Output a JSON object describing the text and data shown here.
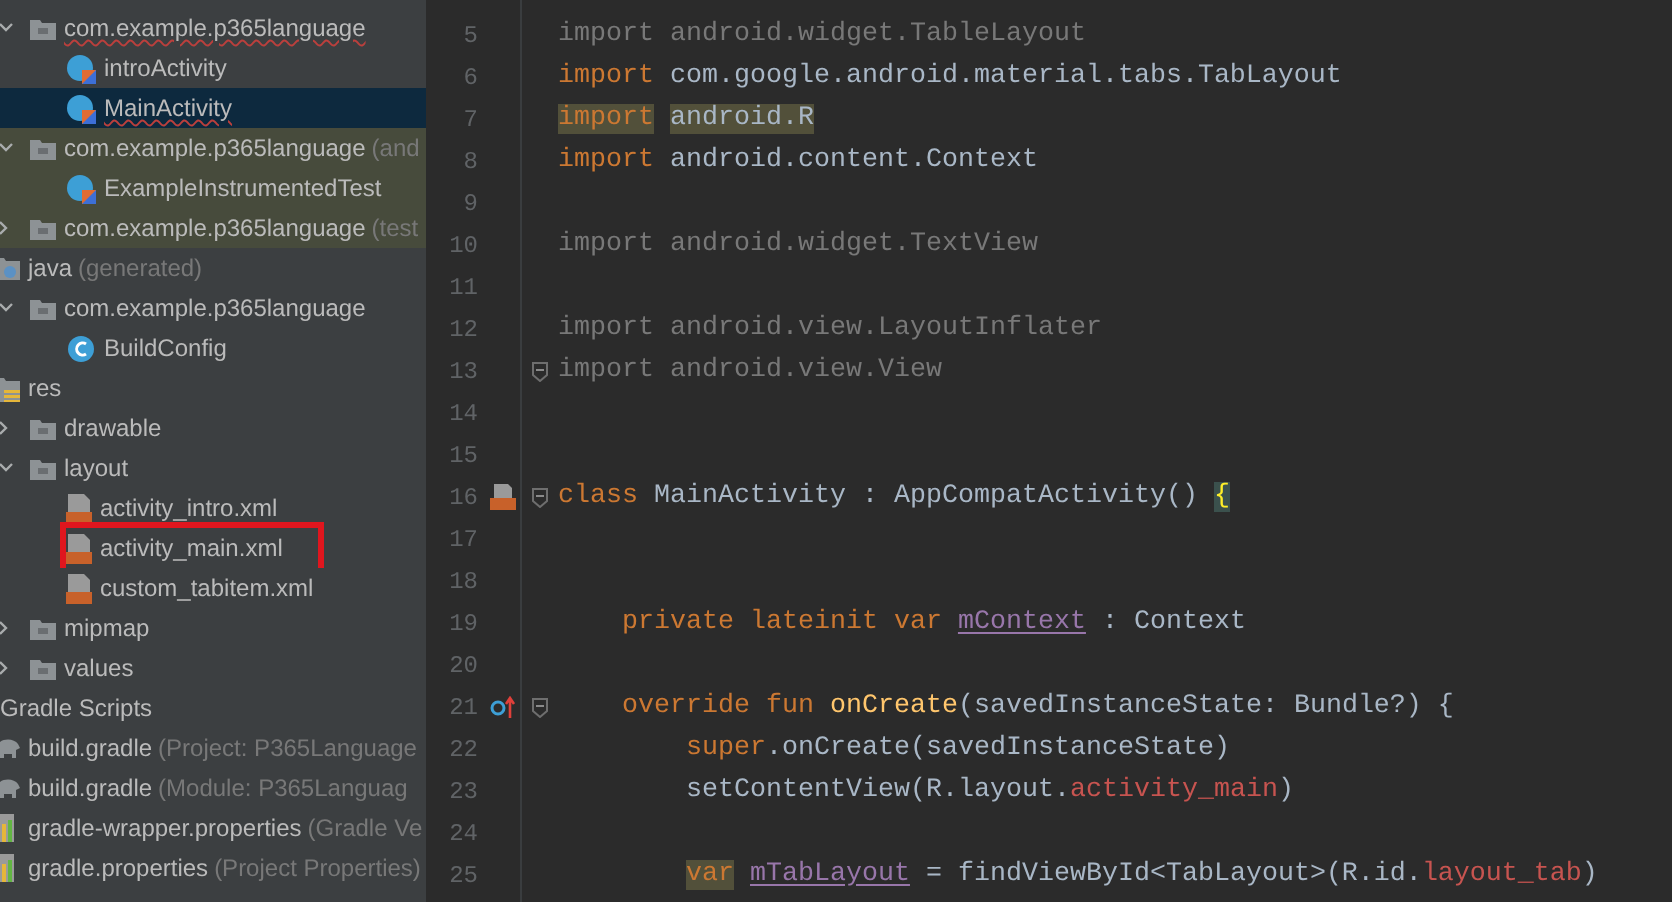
{
  "project_tree": {
    "continued": [
      {
        "label": "com.example.p365language",
        "kind": "package",
        "expanded": true,
        "selected": false,
        "test_scope": false,
        "spell_error": true,
        "children": [
          {
            "label": "introActivity",
            "kind": "kotlin-class",
            "selected": false,
            "test_scope": false,
            "spell_error": false
          },
          {
            "label": "MainActivity",
            "kind": "kotlin-class",
            "selected": true,
            "test_scope": false,
            "spell_error": true
          }
        ]
      },
      {
        "label": "com.example.p365language",
        "note": "(and",
        "kind": "package",
        "expanded": true,
        "selected": false,
        "test_scope": true,
        "spell_error": false,
        "children": [
          {
            "label": "ExampleInstrumentedTest",
            "kind": "kotlin-class",
            "selected": false,
            "test_scope": true,
            "spell_error": false
          }
        ]
      },
      {
        "label": "com.example.p365language",
        "note": "(test",
        "kind": "package",
        "expanded": false,
        "selected": false,
        "test_scope": true,
        "spell_error": false
      }
    ],
    "items": [
      {
        "label": "java",
        "note": "(generated)",
        "kind": "generated-folder",
        "selected": false,
        "test_scope": false,
        "spell_error": false,
        "children": [
          {
            "label": "com.example.p365language",
            "kind": "package",
            "expanded": true,
            "selected": false,
            "test_scope": false,
            "spell_error": false,
            "children": [
              {
                "label": "BuildConfig",
                "kind": "java-class",
                "selected": false,
                "test_scope": false,
                "spell_error": false
              }
            ]
          }
        ]
      },
      {
        "label": "res",
        "kind": "resource-folder",
        "selected": false,
        "test_scope": false,
        "spell_error": false,
        "children": [
          {
            "label": "drawable",
            "kind": "package",
            "expanded": false,
            "selected": false,
            "test_scope": false,
            "spell_error": false
          },
          {
            "label": "layout",
            "kind": "package",
            "expanded": true,
            "selected": false,
            "test_scope": false,
            "spell_error": false,
            "children": [
              {
                "label": "activity_intro.xml",
                "kind": "xml-file",
                "selected": false,
                "test_scope": false,
                "spell_error": false,
                "outlined": false
              },
              {
                "label": "activity_main.xml",
                "kind": "xml-file",
                "selected": false,
                "test_scope": false,
                "spell_error": false,
                "outlined": true
              },
              {
                "label": "custom_tabitem.xml",
                "kind": "xml-file",
                "selected": false,
                "test_scope": false,
                "spell_error": false,
                "outlined": false
              }
            ]
          },
          {
            "label": "mipmap",
            "kind": "package",
            "expanded": false,
            "selected": false,
            "test_scope": false,
            "spell_error": false
          },
          {
            "label": "values",
            "kind": "package",
            "expanded": false,
            "selected": false,
            "test_scope": false,
            "spell_error": false
          }
        ]
      }
    ],
    "gradle_scripts": {
      "label": "Gradle Scripts",
      "children": [
        {
          "label": "build.gradle",
          "note": "(Project: P365Language",
          "kind": "gradle-file",
          "selected": false,
          "test_scope": false,
          "spell_error": false
        },
        {
          "label": "build.gradle",
          "note": "(Module: P365Languag",
          "kind": "gradle-file",
          "selected": false,
          "test_scope": false,
          "spell_error": false
        },
        {
          "label": "gradle-wrapper.properties",
          "note": "(Gradle Ve",
          "kind": "properties-file",
          "selected": false,
          "test_scope": false,
          "spell_error": false
        },
        {
          "label": "gradle.properties",
          "note": "(Project Properties)",
          "kind": "properties-file",
          "selected": false,
          "test_scope": false,
          "spell_error": false
        }
      ]
    }
  },
  "editor": {
    "lines": [
      {
        "number": "5",
        "fold": false,
        "segments": [
          {
            "text": "import android.widget.TableLayout",
            "kind": "unused"
          }
        ]
      },
      {
        "number": "6",
        "fold": false,
        "segments": [
          {
            "text": "import",
            "kind": "keyword"
          },
          {
            "text": " com.google.android.material.tabs.TabLayout",
            "kind": "plain"
          }
        ]
      },
      {
        "number": "7",
        "fold": false,
        "segments": [
          {
            "text": "import",
            "kind": "keyword-marked"
          },
          {
            "text": " android.R",
            "kind": "plain-marked"
          }
        ]
      },
      {
        "number": "8",
        "fold": false,
        "segments": [
          {
            "text": "import",
            "kind": "keyword"
          },
          {
            "text": " android.content.Context",
            "kind": "plain"
          }
        ]
      },
      {
        "number": "9",
        "fold": false
      },
      {
        "number": "10",
        "fold": false,
        "segments": [
          {
            "text": "import android.widget.TextView",
            "kind": "unused"
          }
        ]
      },
      {
        "number": "11",
        "fold": false
      },
      {
        "number": "12",
        "fold": false,
        "segments": [
          {
            "text": "import android.view.LayoutInflater",
            "kind": "unused"
          }
        ]
      },
      {
        "number": "13",
        "fold": true,
        "segments": [
          {
            "text": "import android.view.View",
            "kind": "unused"
          }
        ]
      },
      {
        "number": "14",
        "fold": false
      },
      {
        "number": "15",
        "fold": false
      },
      {
        "number": "16",
        "fold": true,
        "gutter_icon": {
          "kind": "layout-file"
        },
        "segments": [
          {
            "text": "class",
            "kind": "keyword"
          },
          {
            "text": " MainActivity : AppCompatActivity() ",
            "kind": "plain"
          },
          {
            "text": "{",
            "kind": "brace-marked"
          }
        ]
      },
      {
        "number": "17",
        "fold": false
      },
      {
        "number": "18",
        "fold": false
      },
      {
        "number": "19",
        "fold": false,
        "segments": [
          {
            "text": "    private lateinit var ",
            "kind": "keyword"
          },
          {
            "text": "mContext",
            "kind": "property"
          },
          {
            "text": " : Context",
            "kind": "plain"
          }
        ]
      },
      {
        "number": "20",
        "fold": false
      },
      {
        "number": "21",
        "fold": true,
        "gutter_icon": {
          "kind": "override"
        },
        "segments": [
          {
            "text": "    override fun ",
            "kind": "keyword"
          },
          {
            "text": "onCreate",
            "kind": "function"
          },
          {
            "text": "(savedInstanceState: Bundle?) {",
            "kind": "plain"
          }
        ]
      },
      {
        "number": "22",
        "fold": false,
        "segments": [
          {
            "text": "        super",
            "kind": "keyword"
          },
          {
            "text": ".onCreate(savedInstanceState)",
            "kind": "plain"
          }
        ]
      },
      {
        "number": "23",
        "fold": false,
        "segments": [
          {
            "text": "        setContentView(R.layout.",
            "kind": "plain"
          },
          {
            "text": "activity_main",
            "kind": "resource"
          },
          {
            "text": ")",
            "kind": "plain"
          }
        ]
      },
      {
        "number": "24",
        "fold": false
      },
      {
        "number": "25",
        "fold": false,
        "segments": [
          {
            "text": "        var",
            "kind": "keyword-marked"
          },
          {
            "text": " mTabLayout",
            "kind": "property"
          },
          {
            "text": " = findViewById<TabLayout>(R.id.",
            "kind": "plain"
          },
          {
            "text": "layout_tab",
            "kind": "resource"
          },
          {
            "text": ")",
            "kind": "plain"
          }
        ]
      }
    ]
  }
}
